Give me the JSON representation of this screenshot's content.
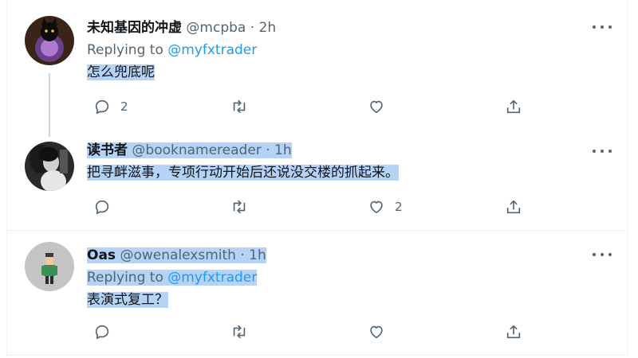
{
  "tweets": [
    {
      "name": "未知基因的冲虚",
      "handle": "@mcpba",
      "dot": "·",
      "time": "2h",
      "replying_prefix": "Replying to ",
      "replying_to": "@myfxtrader",
      "text": "怎么兜底呢",
      "reply_count": "2",
      "retweet_count": "",
      "like_count": ""
    },
    {
      "name": "读书者",
      "handle": "@booknamereader",
      "dot": "·",
      "time": "1h",
      "text": "把寻衅滋事，专项行动开始后还说没交楼的抓起来。",
      "reply_count": "",
      "retweet_count": "",
      "like_count": "2"
    },
    {
      "name": "Oas",
      "handle": "@owenalexsmith",
      "dot": "·",
      "time": "1h",
      "replying_prefix": "Replying to ",
      "replying_to": "@myfxtrader",
      "text": "表演式复工？",
      "reply_count": "",
      "retweet_count": "",
      "like_count": ""
    }
  ],
  "icons": {
    "reply": "reply-icon",
    "retweet": "retweet-icon",
    "like": "like-icon",
    "share": "share-icon",
    "more": "more-icon"
  },
  "colors": {
    "link": "#1d9bf0",
    "muted": "#536471",
    "selection": "#b5d3f7"
  }
}
